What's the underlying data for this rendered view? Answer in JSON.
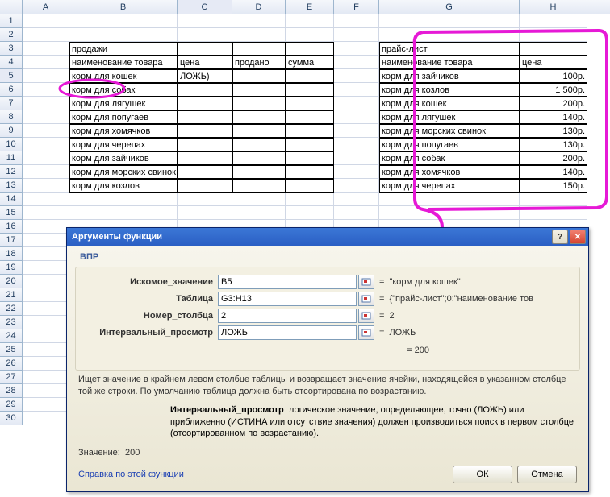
{
  "columns": [
    "A",
    "B",
    "C",
    "D",
    "E",
    "F",
    "G",
    "H"
  ],
  "rows": 30,
  "grid": {
    "B3": "продажи",
    "B4": "наименование товара",
    "C4": "цена",
    "D4": "продано",
    "E4": "сумма",
    "B5": "корм для кошек",
    "C5": "ЛОЖЬ)",
    "B6": "корм для собак",
    "B7": "корм для лягушек",
    "B8": "корм для попугаев",
    "B9": "корм для хомячков",
    "B10": "корм для черепах",
    "B11": "корм для зайчиков",
    "B12": "корм для морских свинок",
    "B13": "корм для козлов",
    "G3": "прайс-лист",
    "G4": "наименование товара",
    "H4": "цена",
    "G5": "корм для зайчиков",
    "H5": "100р.",
    "G6": "корм для козлов",
    "H6": "1 500р.",
    "G7": "корм для кошек",
    "H7": "200р.",
    "G8": "корм для лягушек",
    "H8": "140р.",
    "G9": "корм для морских свинок",
    "H9": "130р.",
    "G10": "корм для попугаев",
    "H10": "130р.",
    "G11": "корм для собак",
    "H11": "200р.",
    "G12": "корм для хомячков",
    "H12": "140р.",
    "G13": "корм для черепах",
    "H13": "150р."
  },
  "dialog": {
    "title": "Аргументы функции",
    "func": "ВПР",
    "args": {
      "a1": {
        "label": "Искомое_значение",
        "val": "B5",
        "res": "\"корм для кошек\""
      },
      "a2": {
        "label": "Таблица",
        "val": "G3:H13",
        "res": "{\"прайс-лист\";0:\"наименование тов"
      },
      "a3": {
        "label": "Номер_столбца",
        "val": "2",
        "res": "2"
      },
      "a4": {
        "label": "Интервальный_просмотр",
        "val": "ЛОЖЬ",
        "res": "ЛОЖЬ"
      }
    },
    "overall_result": "= 200",
    "desc": "Ищет значение в крайнем левом столбце таблицы и возвращает значение ячейки, находящейся в указанном столбце той же строки. По умолчанию таблица должна быть отсортирована по возрастанию.",
    "arg_desc_label": "Интервальный_просмотр",
    "arg_desc": "логическое значение, определяющее, точно (ЛОЖЬ) или приближенно (ИСТИНА или отсутствие значения) должен производиться поиск в первом столбце (отсортированном по возрастанию).",
    "value_label": "Значение:",
    "value": "200",
    "help": "Справка по этой функции",
    "ok": "ОК",
    "cancel": "Отмена"
  }
}
